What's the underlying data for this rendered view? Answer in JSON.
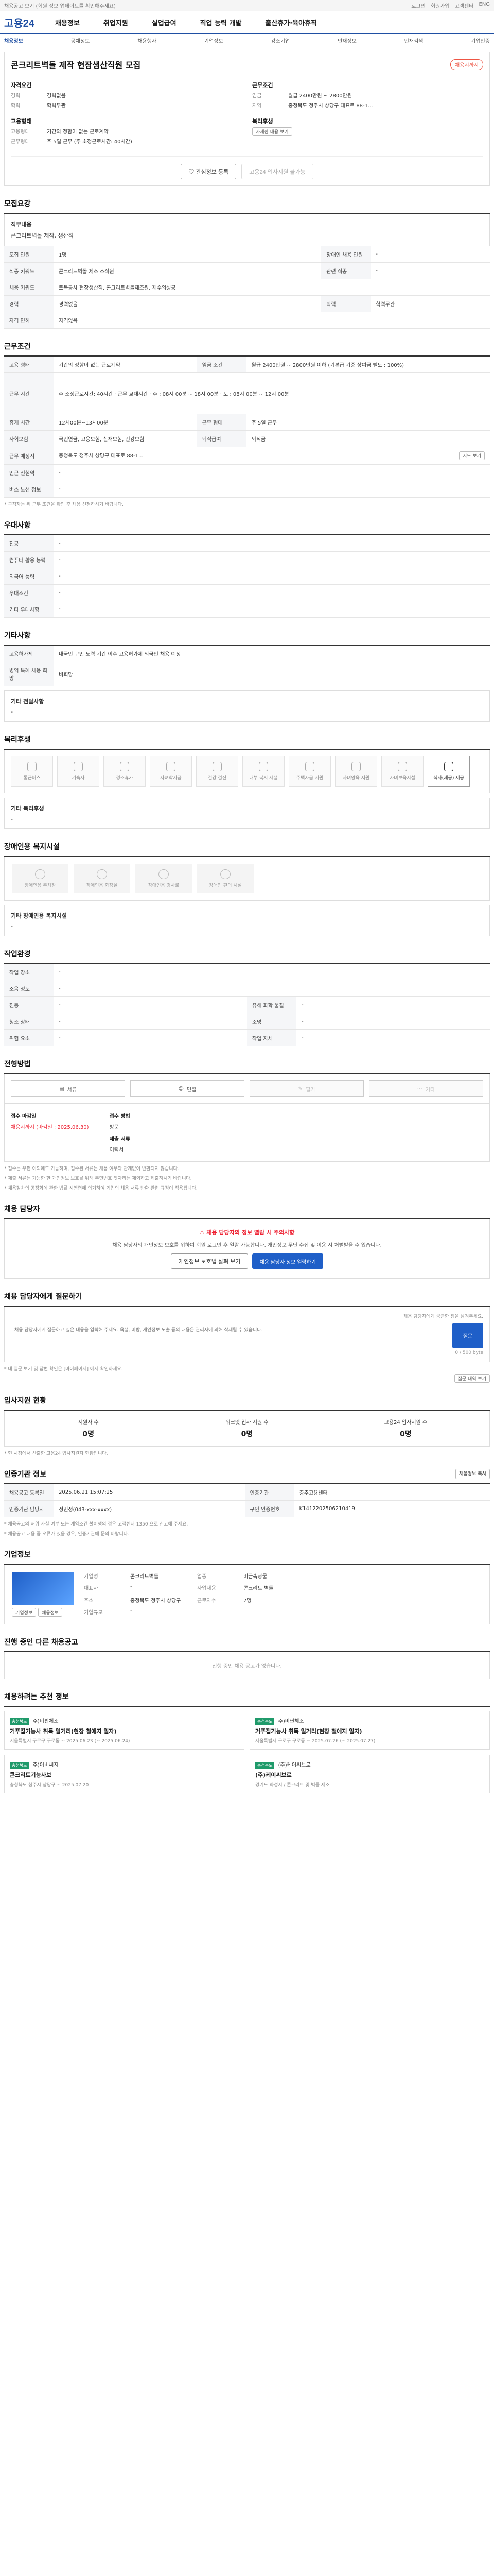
{
  "topbar": {
    "left": "채용공고 보기 (회원 정보 업데이트를 확인해주세요)",
    "links": [
      "로그인",
      "회원가입",
      "고객센터",
      "ENG"
    ]
  },
  "header": {
    "logo": "고용24",
    "nav": [
      "채용정보",
      "취업지원",
      "실업급여",
      "직업 능력 개발",
      "출산휴가·육아휴직"
    ]
  },
  "subnav": {
    "items": [
      "채용정보",
      "공채정보",
      "채용행사",
      "기업정보",
      "강소기업",
      "인재정보",
      "인재검색",
      "기업인증"
    ],
    "active_index": 0
  },
  "job": {
    "title": "콘크리트벽돌 제작 현장생산직원 모집",
    "badge": "채용시까지",
    "left_group1_title": "자격요건",
    "left_rows": [
      {
        "k": "경력",
        "v": "경력없음"
      },
      {
        "k": "학력",
        "v": "학력무관"
      }
    ],
    "right_group1_title": "근무조건",
    "right_rows": [
      {
        "k": "임금",
        "v": "월급 2400만원 ~ 2800만원"
      },
      {
        "k": "지역",
        "v": "충청북도 청주시 상당구 대표로 88-1..."
      }
    ],
    "left_group2_title": "고용형태",
    "left_rows2": [
      {
        "k": "고용형태",
        "v": "기간의 정함이 없는 근로계약"
      },
      {
        "k": "근무형태",
        "v": "주 5일 근무 (주 소정근로시간: 40시간)"
      }
    ],
    "right_group2_title": "복리후생",
    "right_tag": "자세한 내용 보기",
    "btn_interest": "관심정보 등록",
    "btn_apply": "고용24 입사지원 불가능"
  },
  "sec1": {
    "title": "모집요강",
    "duty_label": "직무내용",
    "duty_value": "콘크리트벽돌 제작, 생산직",
    "rows": [
      {
        "k": "모집 인원",
        "v": "1명",
        "k2": "장애인 채용 인원",
        "v2": "-"
      },
      {
        "k": "직종 키워드",
        "v": "콘크리트벽돌 제조 조작원",
        "k2": "관련 직종",
        "v2": "-"
      },
      {
        "k": "채용 키워드",
        "v": "토목공사 현장생산직, 콘크리트벽돌제조원, 재수의성공",
        "k2": "",
        "v2": ""
      },
      {
        "k": "경력",
        "v": "경력없음",
        "k2": "학력",
        "v2": "학력무관"
      },
      {
        "k": "자격 면허",
        "v": "자격없음",
        "k2": "",
        "v2": ""
      }
    ]
  },
  "sec2": {
    "title": "근무조건",
    "rows": [
      {
        "k": "고용 형태",
        "v": "기간의 정함이 없는 근로계약",
        "k2": "임금 조건",
        "v2": "월급 2400만원 ~ 2800만원 이하 (기본급 기준 상여금 별도 : 100%)"
      },
      {
        "k": "근무 시간",
        "v": "주 소정근로시간: 40시간 · 근무 교대시간 · 주 : 08시 00분 ~ 18시 00분 · 토 : 08시 00분 ~ 12시 00분",
        "k2": "",
        "v2": ""
      },
      {
        "k": "휴게 시간",
        "v": "12시00분~13시00분",
        "k2": "근무 형태",
        "v2": "주 5일 근무"
      },
      {
        "k": "사회보험",
        "v": "국민연금, 고용보험, 산재보험, 건강보험",
        "k2": "퇴직급여",
        "v2": "퇴직금"
      },
      {
        "k": "근무 예정지",
        "v": "충청북도 청주시 상당구 대표로 88-1...",
        "k2": "",
        "v2": ""
      },
      {
        "k": "인근 전철역",
        "v": "-",
        "k2": "",
        "v2": ""
      },
      {
        "k": "버스 노선 정보",
        "v": "-",
        "k2": "",
        "v2": ""
      }
    ],
    "map_btn": "지도 보기",
    "note": "* 구직자는 위 근무 조건을 확인 후 채용 신청하시기 바랍니다."
  },
  "sec3": {
    "title": "우대사항",
    "rows": [
      {
        "k": "전공",
        "v": "-"
      },
      {
        "k": "컴퓨터 활용 능력",
        "v": "-"
      },
      {
        "k": "외국어 능력",
        "v": "-"
      },
      {
        "k": "우대조건",
        "v": "-"
      },
      {
        "k": "기타 우대사항",
        "v": "-"
      }
    ]
  },
  "sec4": {
    "title": "기타사항",
    "rows": [
      {
        "k": "고용허가제",
        "v": "내국인 구인 노력 기간 이후 고용허가제 외국인 채용 예정"
      },
      {
        "k": "병역 특례 채용 희망",
        "v": "비희망"
      }
    ],
    "more": "기타 전달사항",
    "more_value": "-"
  },
  "sec5": {
    "title": "복리후생",
    "items": [
      "통근버스",
      "기숙사",
      "경조휴가",
      "자녀학자금",
      "건강 검진",
      "내부 복지 시설",
      "주택자금 지원",
      "자녀양육 지원",
      "자녀보육시설",
      "식사(제공) 제공"
    ],
    "on": [
      9
    ],
    "etc_label": "기타 복리후생",
    "etc_value": "-"
  },
  "sec6": {
    "title": "장애인용 복지시설",
    "items": [
      "장애인용 주차장",
      "장애인용 화장실",
      "장애인용 경사로",
      "장애인 편의 시설"
    ],
    "etc_label": "기타 장애인용 복지시설",
    "etc_value": "-"
  },
  "sec7": {
    "title": "작업환경",
    "rows": [
      {
        "k": "작업 장소",
        "v": "-",
        "k2": "",
        "v2": ""
      },
      {
        "k": "소음 정도",
        "v": "-",
        "k2": "",
        "v2": ""
      },
      {
        "k": "진동",
        "v": "-",
        "k2": "유해 화학 물질",
        "v2": "-"
      },
      {
        "k": "청소 상태",
        "v": "-",
        "k2": "조명",
        "v2": "-"
      },
      {
        "k": "위험 요소",
        "v": "-",
        "k2": "작업 자세",
        "v2": "-"
      }
    ]
  },
  "sec8": {
    "title": "전형방법",
    "methods": [
      "서류",
      "면접",
      "필기",
      "기타"
    ],
    "dim": [
      2,
      3
    ],
    "period_label": "접수 마감일",
    "period_value": "채용시까지 (마감일 : 2025.06.30)",
    "method_label": "접수 방법",
    "method_value": "방문",
    "doc_label": "제출 서류",
    "doc_value": "이력서",
    "notes": [
      "* 접수는 우편 이외에도 가능하며, 접수된 서류는 채용 여부와 관계없이 반환되지 않습니다.",
      "* 제출 서류는 가능한 한 개인정보 보호를 위해 주민번호 뒷자리는 제외하고 제출하시기 바랍니다.",
      "* 채용절차의 공정화에 관한 법률 시행령에 의거하여 기업의 채용 서류 반환 관련 규정이 적용됩니다."
    ]
  },
  "sec9": {
    "title": "채용 담당자",
    "warn": "채용 담당자의 정보 열람 시 주의사항",
    "desc": "채용 담당자의 개인정보 보호를 위하여 회원 로그인 후 열람 가능합니다. 개인정보 무단 수집 및 이용 시 처벌받을 수 있습니다.",
    "btn1": "개인정보 보호법 살펴 보기",
    "btn2": "채용 담당자 정보 열람하기"
  },
  "sec10": {
    "title": "채용 담당자에게 질문하기",
    "hint": "채용 담당자에게 궁금한 점을 남겨주세요.",
    "placeholder": "채용 담당자에게 질문하고 싶은 내용을 입력해 주세요. 욕설, 비방, 개인정보 노출 등의 내용은 관리자에 의해 삭제될 수 있습니다.",
    "counter": "0 / 500 byte",
    "submit": "질문",
    "note": "* 내 질문 보기 및 답변 확인은 [마이페이지] 에서 확인하세요.",
    "view_btn": "질문 내역 보기"
  },
  "sec11": {
    "title": "입사지원 현황",
    "stats": [
      {
        "label": "지원자 수",
        "value": "0명"
      },
      {
        "label": "워크넷 입사 지원 수",
        "value": "0명"
      },
      {
        "label": "고용24 입사지원 수",
        "value": "0명"
      }
    ],
    "note": "* 현 시점에서 산출한 고용24 입사지원자 현황입니다."
  },
  "sec12": {
    "title": "인증기관 정보",
    "copy_btn": "채용정보 복사",
    "rows": [
      {
        "k": "채용공고 등록일",
        "v": "2025.06.21 15:07:25",
        "k2": "인증기관",
        "v2": "충주고용센터"
      },
      {
        "k": "인증기관 담당자",
        "v": "정민정(043-xxx-xxxx)",
        "k2": "구인 인증번호",
        "v2": "K1412202506210419"
      }
    ],
    "notes": [
      "* 채용공고의 허위 사실 여부 또는 계약조건 불이행의 경우 고객센터 1350 으로 신고해 주세요.",
      "* 채용공고 내용 중 오류가 있을 경우, 인증기관에 문의 바랍니다."
    ]
  },
  "sec13": {
    "title": "기업정보",
    "rows": [
      {
        "k": "기업명",
        "v": "콘크리트벽돌",
        "k2": "업종",
        "v2": "비금속광물"
      },
      {
        "k": "대표자",
        "v": "-",
        "k2": "사업내용",
        "v2": "콘크리트 벽돌"
      },
      {
        "k": "주소",
        "v": "충청북도 청주시 상당구",
        "k2": "근로자수",
        "v2": "7명"
      },
      {
        "k": "기업규모",
        "v": "-",
        "k2": "",
        "v2": ""
      }
    ],
    "btn1": "기업정보",
    "btn2": "채용정보"
  },
  "sec14": {
    "title": "진행 중인 다른 채용공고",
    "empty": "진행 중인 채용 공고가 없습니다."
  },
  "sec15": {
    "title": "채용하려는 추천 정보",
    "items": [
      {
        "tag": "충청북도",
        "ttl": "거푸집기능사 취득 일거리(현장 철에지 일자)",
        "company": "주)비싼체조",
        "meta": "서울특별시 구로구 구로동 ~ 2025.06.23 (~ 2025.06.24)"
      },
      {
        "tag": "충청북도",
        "ttl": "거푸집기능사 취득 일거리(현장 철에지 일자)",
        "company": "주)비싼체조",
        "meta": "서울특별시 구로구 구로동 ~ 2025.07.26 (~ 2025.07.27)"
      },
      {
        "tag": "충청북도",
        "ttl": "콘크리트기능사보",
        "company": "주)이비씨지",
        "meta": "충청북도 청주시 상당구 ~ 2025.07.20"
      },
      {
        "tag": "충청북도",
        "ttl": "(주)케이씨브로",
        "company": "(주)케이씨브로",
        "meta": "경기도 화성시 / 콘크리트 및 벽돌 제조"
      }
    ]
  }
}
